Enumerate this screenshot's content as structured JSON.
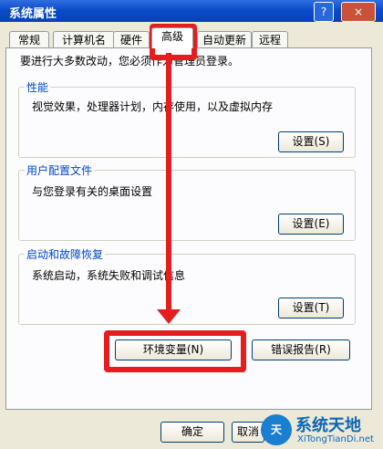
{
  "window": {
    "title": "系统属性",
    "help_glyph": "?",
    "close_glyph": "×"
  },
  "tabs": [
    "常规",
    "计算机名",
    "硬件",
    "高级",
    "自动更新",
    "远程"
  ],
  "admin_note": "要进行大多数改动，您必须作为管理员登录。",
  "performance": {
    "title": "性能",
    "desc": "视觉效果，处理器计划，内存使用，以及虚拟内存",
    "button": "设置(S)"
  },
  "profiles": {
    "title": "用户配置文件",
    "desc": "与您登录有关的桌面设置",
    "button": "设置(E)"
  },
  "startup": {
    "title": "启动和故障恢复",
    "desc": "系统启动，系统失败和调试信息",
    "button": "设置(T)"
  },
  "env_button": "环境变量(N)",
  "error_button": "错误报告(R)",
  "bottom": {
    "ok": "确定",
    "cancel": "取消"
  },
  "watermark": {
    "icon": "天",
    "name": "系统天地",
    "url": "XiTongTianDi.net"
  }
}
